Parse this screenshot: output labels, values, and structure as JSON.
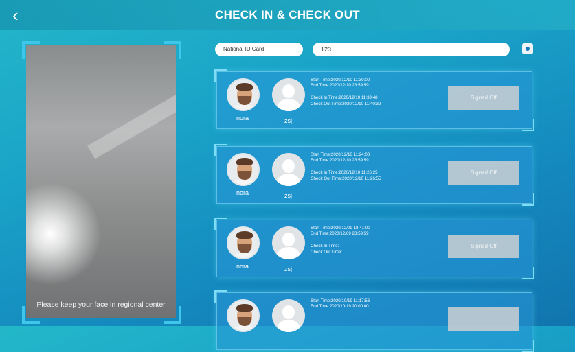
{
  "header": {
    "title": "CHECK IN & CHECK OUT",
    "back_icon": "chevron-left-icon"
  },
  "camera": {
    "hint": "Please keep your face in regional center"
  },
  "search": {
    "type_label": "National ID Card",
    "value": "123"
  },
  "records": [
    {
      "name1": "nora",
      "name2": "zsj",
      "start": "Start Time:2020/12/10 11:39:00",
      "end": "End Time:2020/12/10 23:59:59",
      "checkin": "Check In Time:2020/12/10 11:39:48",
      "checkout": "Check Out Time:2020/12/10 11:40:32",
      "button": "Signed Off"
    },
    {
      "name1": "nora",
      "name2": "zsj",
      "start": "Start Time:2020/12/10 11:24:00",
      "end": "End Time:2020/12/10 23:59:59",
      "checkin": "Check In Time:2020/12/10 11:26:25",
      "checkout": "Check Out Time:2020/12/10 11:26:55",
      "button": "Signed Off"
    },
    {
      "name1": "nora",
      "name2": "zsj",
      "start": "Start Time:2020/12/09 18:41:00",
      "end": "End Time:2020/12/09 23:59:59",
      "checkin": "Check In Time:",
      "checkout": "Check Out Time:",
      "button": "Signed Off"
    },
    {
      "name1": "",
      "name2": "",
      "start": "Start Time:2020/10/19 11:17:56",
      "end": "End Time:2020/10/19 20:00:00",
      "checkin": "",
      "checkout": "",
      "button": ""
    }
  ]
}
